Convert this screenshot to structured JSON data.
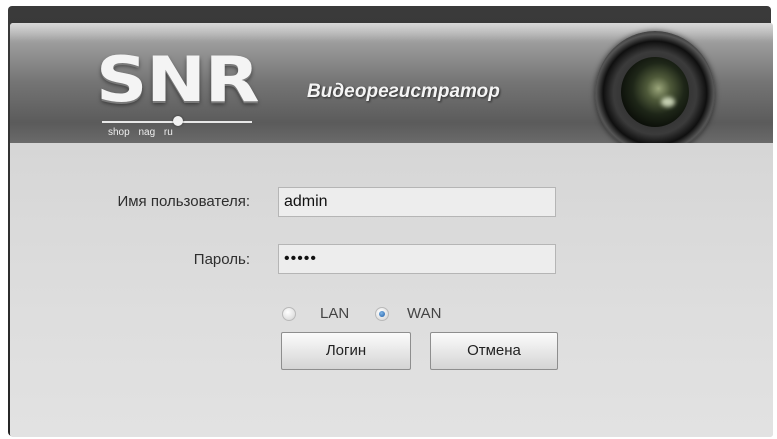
{
  "header": {
    "logo_text": "SNR",
    "logo_subtext": "shop nag ru",
    "title": "Видеорегистратор"
  },
  "login_form": {
    "username_label": "Имя пользователя:",
    "username_value": "admin",
    "password_label": "Пароль:",
    "password_value": "•••••",
    "network_options": [
      {
        "label": "LAN",
        "checked": false
      },
      {
        "label": "WAN",
        "checked": true
      }
    ],
    "login_button": "Логин",
    "cancel_button": "Отмена"
  },
  "colors": {
    "radio_selected": "#1f5fa8",
    "panel_background": "#dcdcdc",
    "header_dark": "#5b5b5b"
  },
  "icons": [
    "camera-lens-icon"
  ]
}
